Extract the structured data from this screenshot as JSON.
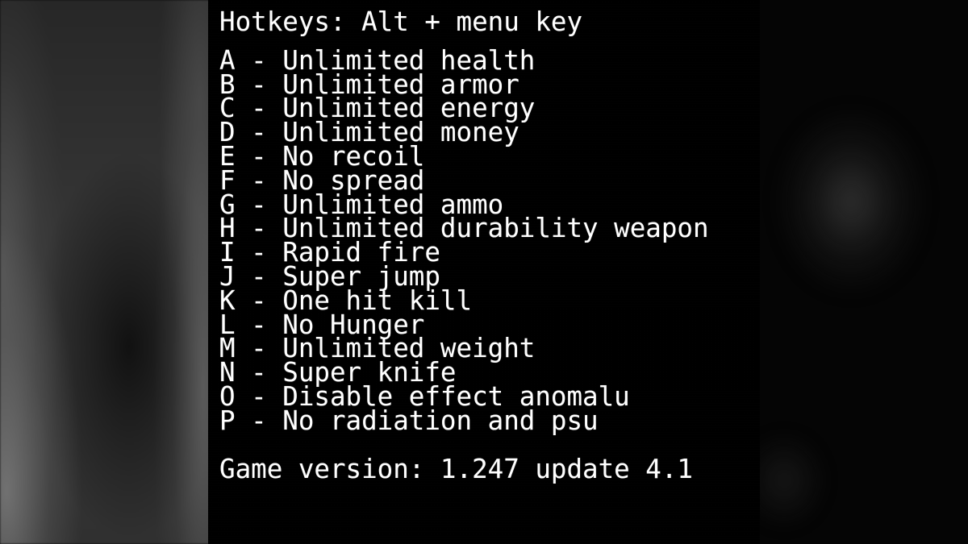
{
  "overlay": {
    "header": "Hotkeys: Alt + menu key",
    "hotkeys": [
      {
        "key": "A",
        "sep": "-",
        "label": "Unlimited health",
        "line": "A - Unlimited health"
      },
      {
        "key": "B",
        "sep": "-",
        "label": "Unlimited armor",
        "line": "B - Unlimited armor"
      },
      {
        "key": "C",
        "sep": "-",
        "label": "Unlimited energy",
        "line": "C - Unlimited energy"
      },
      {
        "key": "D",
        "sep": "-",
        "label": "Unlimited money",
        "line": "D - Unlimited money"
      },
      {
        "key": "E",
        "sep": "-",
        "label": "No recoil",
        "line": "E - No recoil"
      },
      {
        "key": "F",
        "sep": "-",
        "label": "No spread",
        "line": "F - No spread"
      },
      {
        "key": "G",
        "sep": "-",
        "label": "Unlimited ammo",
        "line": "G - Unlimited ammo"
      },
      {
        "key": "H",
        "sep": "-",
        "label": "Unlimited durability weapon",
        "line": "H - Unlimited durability weapon"
      },
      {
        "key": "I",
        "sep": "-",
        "label": "Rapid fire",
        "line": "I - Rapid fire"
      },
      {
        "key": "J",
        "sep": "-",
        "label": "Super jump",
        "line": "J - Super jump"
      },
      {
        "key": "K",
        "sep": "-",
        "label": "One hit kill",
        "line": "K - One hit kill"
      },
      {
        "key": "L",
        "sep": "-",
        "label": "No Hunger",
        "line": "L - No Hunger"
      },
      {
        "key": "M",
        "sep": "-",
        "label": "Unlimited weight",
        "line": "M - Unlimited weight"
      },
      {
        "key": "N",
        "sep": "-",
        "label": "Super knife",
        "line": "N - Super knife"
      },
      {
        "key": "O",
        "sep": "-",
        "label": "Disable effect anomalu",
        "line": "O - Disable effect anomalu"
      },
      {
        "key": "P",
        "sep": "-",
        "label": "No radiation and psu",
        "line": "P - No radiation and psu"
      }
    ],
    "game_version": "Game version: 1.247 update 4.1"
  },
  "colors": {
    "panel_background": "#000000",
    "text": "#ffffff",
    "backdrop_grey": "#343434"
  }
}
